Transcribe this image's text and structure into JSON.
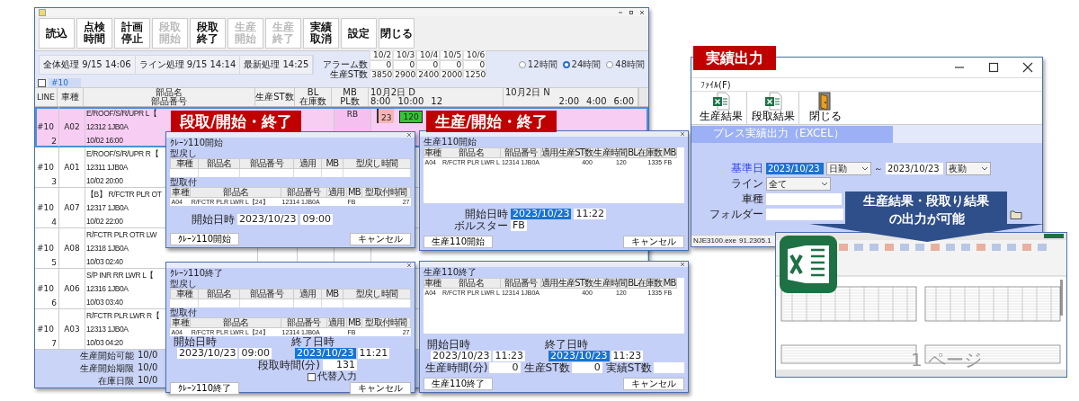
{
  "main_window": {
    "toolbar": [
      {
        "label": "読込",
        "disabled": false
      },
      {
        "label": "点検時間",
        "disabled": false
      },
      {
        "label": "計画停止",
        "disabled": false
      },
      {
        "label": "段取開始",
        "disabled": true
      },
      {
        "label": "段取終了",
        "disabled": false
      },
      {
        "label": "生産開始",
        "disabled": true
      },
      {
        "label": "生産終了",
        "disabled": true
      },
      {
        "label": "実績取消",
        "disabled": false
      },
      {
        "label": "設定",
        "disabled": false
      },
      {
        "label": "閉じる",
        "disabled": false
      }
    ],
    "status_texts": [
      "全体処理 9/15 14:06",
      "ライン処理 9/15 14:14",
      "最新処理 14:25"
    ],
    "summary": {
      "dates": [
        "10/2",
        "10/3",
        "10/4",
        "10/5",
        "10/6"
      ],
      "rows": [
        {
          "label": "アラーム数",
          "values": [
            "0",
            "0",
            "0",
            "0",
            "0"
          ]
        },
        {
          "label": "生産ST数",
          "values": [
            "3850",
            "2900",
            "2400",
            "2000",
            "1250"
          ]
        }
      ]
    },
    "range_options": [
      {
        "label": "12時間",
        "selected": false
      },
      {
        "label": "24時間",
        "selected": true
      },
      {
        "label": "48時間",
        "selected": false
      }
    ],
    "line_filter": {
      "checked": false,
      "label": "#10"
    },
    "grid": {
      "columns": [
        {
          "label": "LINE"
        },
        {
          "label": "車種"
        },
        {
          "label": "部品名",
          "sublabel": "部品番号"
        },
        {
          "label": "生産ST数"
        },
        {
          "label": "BL",
          "sublabel": "在庫数"
        },
        {
          "label": "MB",
          "sublabel": "PL数"
        }
      ],
      "timeline": [
        {
          "label": "10月2日 D",
          "times": [
            "8:00",
            "10:00",
            "12"
          ]
        },
        {
          "label": "10月2日 N",
          "times": [
            "2:00",
            "4:00",
            "6:00"
          ]
        }
      ],
      "rows": [
        {
          "line": "#10",
          "seq": "2",
          "model": "A02",
          "part_name": "E/ROOF/S/R/UPR L【",
          "part_no": "12312 1JB0A",
          "time": "10/02 16:00",
          "selected": true,
          "mb": "RB",
          "bars": [
            {
              "kind": "setup",
              "text": "23"
            },
            {
              "kind": "production",
              "text": "120"
            }
          ]
        },
        {
          "line": "#10",
          "seq": "3",
          "model": "A01",
          "part_name": "E/ROOF/S/R/UPR R【",
          "part_no": "12311 1JB0A",
          "time": "10/02 20:00",
          "selected": false
        },
        {
          "line": "#10",
          "seq": "4",
          "model": "A07",
          "part_name": "【B】 R/FCTR PLR OT",
          "part_no": "12317 1JB0A",
          "time": "10/02 22:00",
          "selected": false
        },
        {
          "line": "#10",
          "seq": "5",
          "model": "A08",
          "part_name": "R/FCTR PLR OTR LW",
          "part_no": "12318 1JB0A",
          "time": "10/03 02:40",
          "selected": false
        },
        {
          "line": "#10",
          "seq": "6",
          "model": "A06",
          "part_name": "S/P INR RR LWR L【",
          "part_no": "12316 1JB0A",
          "time": "10/03 03:40",
          "selected": false
        },
        {
          "line": "#10",
          "seq": "7",
          "model": "A03",
          "part_name": "R/FCTR PLR LWR R【",
          "part_no": "12313 1JB0A",
          "time": "10/03 04:20",
          "selected": false
        }
      ]
    },
    "footer": [
      {
        "label": "生産開始可能",
        "value": "10/0"
      },
      {
        "label": "生産開始期限",
        "value": "10/0"
      },
      {
        "label": "在庫日限",
        "value": "10/0"
      }
    ]
  },
  "banners": [
    "段取/開始・終了",
    "生産/開始・終了",
    "実績出力"
  ],
  "dialogs": [
    {
      "kind": "setup",
      "title": "ｸﾚｰﾝ110開始",
      "tables": [
        {
          "caption": "型戻し",
          "columns": [
            "車種",
            "部品名",
            "部品番号",
            "適用",
            "MB",
            "型戻し時間"
          ]
        },
        {
          "caption": "型取付",
          "columns": [
            "車種",
            "部品名",
            "部品番号",
            "適用",
            "MB",
            "型取付時間"
          ],
          "rows": [
            [
              "A04",
              "R/FCTR PLR LWR L【24】",
              "12314 1JB0A",
              "",
              "FB",
              "27"
            ]
          ]
        }
      ],
      "form": [
        [
          {
            "kind": "label",
            "text": "開始日時"
          },
          {
            "kind": "field",
            "value": "2023/10/23",
            "selected": false
          },
          {
            "kind": "field",
            "value": "09:00",
            "selected": false
          }
        ]
      ],
      "buttons": [
        "ｸﾚｰﾝ110開始",
        "キャンセル"
      ]
    },
    {
      "kind": "setup",
      "title": "ｸﾚｰﾝ110終了",
      "tables": [
        {
          "caption": "型戻し",
          "columns": [
            "車種",
            "部品名",
            "部品番号",
            "適用",
            "MB",
            "型戻し時間"
          ]
        },
        {
          "caption": "型取付",
          "columns": [
            "車種",
            "部品名",
            "部品番号",
            "適用",
            "MB",
            "型取付時間"
          ],
          "rows": [
            [
              "A04",
              "R/FCTR PLR LWR L【24】",
              "12314 1JB0A",
              "",
              "FB",
              "27"
            ]
          ]
        }
      ],
      "form": [
        [
          {
            "kind": "stack",
            "label": "開始日時",
            "fields": [
              {
                "value": "2023/10/23",
                "selected": false
              },
              {
                "value": "09:00",
                "selected": false
              }
            ]
          },
          {
            "kind": "stack",
            "label": "終了日時",
            "fields": [
              {
                "value": "2023/10/23",
                "selected": true
              },
              {
                "value": "11:21",
                "selected": false
              }
            ]
          }
        ],
        [
          {
            "kind": "label",
            "text": "段取時間(分)"
          },
          {
            "kind": "number",
            "value": "131",
            "selected": false
          }
        ],
        [
          {
            "kind": "checkbox",
            "text": "代替入力",
            "checked": false
          }
        ]
      ],
      "buttons": [
        "ｸﾚｰﾝ110終了",
        "キャンセル"
      ]
    },
    {
      "kind": "production",
      "title": "生産110開始",
      "tables": [
        {
          "columns": [
            "車種",
            "部品名",
            "部品番号",
            "適用",
            "生産ST数",
            "生産時間",
            "BL在庫数",
            "MB"
          ],
          "rows": [
            [
              "A04",
              "R/FCTR PLR LWR L",
              "12314 1JB0A",
              "",
              "400",
              "120",
              "1335",
              "FB"
            ]
          ]
        }
      ],
      "form": [
        [
          {
            "kind": "label",
            "text": "開始日時"
          },
          {
            "kind": "field",
            "value": "2023/10/23",
            "selected": true
          },
          {
            "kind": "field",
            "value": "11:22",
            "selected": false
          }
        ],
        [
          {
            "kind": "label",
            "text": "ボルスター"
          },
          {
            "kind": "field",
            "value": "FB",
            "selected": false
          }
        ]
      ],
      "buttons": [
        "生産110開始",
        "キャンセル"
      ]
    },
    {
      "kind": "production",
      "title": "生産110終了",
      "tables": [
        {
          "columns": [
            "車種",
            "部品名",
            "部品番号",
            "適用",
            "生産ST数",
            "生産時間",
            "BL在庫数",
            "MB"
          ],
          "rows": [
            [
              "A04",
              "R/FCTR PLR LWR L",
              "12314 1JB0A",
              "",
              "400",
              "120",
              "1335",
              "FB"
            ]
          ]
        }
      ],
      "form": [
        [
          {
            "kind": "stack",
            "label": "開始日時",
            "fields": [
              {
                "value": "2023/10/23",
                "selected": false
              },
              {
                "value": "11:23",
                "selected": false
              }
            ]
          },
          {
            "kind": "stack",
            "label": "終了日時",
            "fields": [
              {
                "value": "2023/10/23",
                "selected": true
              },
              {
                "value": "11:23",
                "selected": false
              }
            ]
          }
        ],
        [
          {
            "kind": "label",
            "text": "生産時間(分)"
          },
          {
            "kind": "number",
            "value": "0",
            "selected": false
          },
          {
            "kind": "label",
            "text": "生産ST数"
          },
          {
            "kind": "number",
            "value": "0",
            "selected": false
          },
          {
            "kind": "label",
            "text": "実績ST数"
          },
          {
            "kind": "number",
            "selected": false
          }
        ]
      ],
      "buttons": [
        "生産110終了",
        "キャンセル"
      ]
    }
  ],
  "export_window": {
    "menu": [
      "ﾌｧｲﾙ(F)"
    ],
    "toolbar": [
      {
        "kind": "excel",
        "label": "生産結果"
      },
      {
        "kind": "excel",
        "label": "段取結果"
      },
      {
        "kind": "door",
        "label": "閉じる"
      }
    ],
    "heading": "プレス実績出力（EXCEL）",
    "form": [
      [
        {
          "kind": "label",
          "text": "基準日",
          "focused": true
        },
        {
          "kind": "field",
          "value": "2023/10/23",
          "selected": true
        },
        {
          "kind": "select",
          "value": "日勤"
        },
        {
          "kind": "text",
          "text": "～"
        },
        {
          "kind": "field",
          "value": "2023/10/23",
          "selected": false
        },
        {
          "kind": "select",
          "value": "夜勤"
        }
      ],
      [
        {
          "kind": "label",
          "text": "ライン",
          "focused": false
        },
        {
          "kind": "select",
          "value": "全て"
        }
      ],
      [
        {
          "kind": "label",
          "text": "車種",
          "focused": false
        },
        {
          "kind": "field",
          "selected": false
        }
      ],
      [
        {
          "kind": "label",
          "text": "フォルダー",
          "focused": false
        },
        {
          "kind": "wide",
          "selected": false
        },
        {
          "kind": "folder"
        }
      ]
    ],
    "status": [
      "NJE3100.exe",
      "91.2305.1"
    ]
  },
  "callout": [
    "生産結果・段取り結果",
    "の出力が可能"
  ],
  "preview": {
    "page_label": "1 ページ"
  }
}
